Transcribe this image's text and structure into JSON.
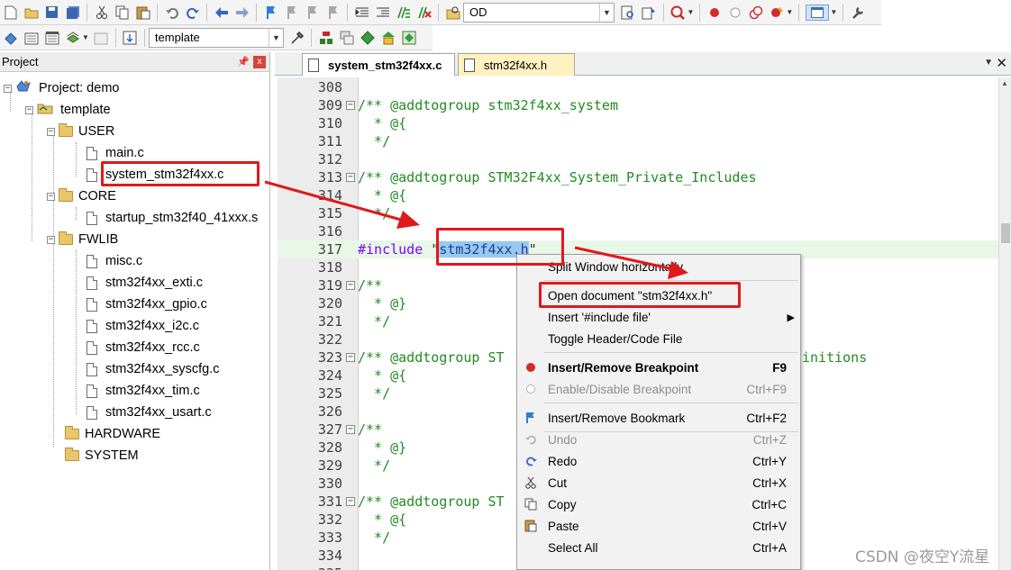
{
  "toolbar1": {
    "target_dropdown": "OD"
  },
  "toolbar2": {
    "target_select": "template"
  },
  "project_panel": {
    "title": "Project",
    "pin": "ᵖ",
    "close": "x",
    "tree": [
      {
        "label": "Project: demo",
        "type": "root"
      },
      {
        "label": "template",
        "type": "target"
      },
      {
        "label": "USER",
        "type": "group"
      },
      {
        "label": "main.c",
        "type": "file"
      },
      {
        "label": "system_stm32f4xx.c",
        "type": "file"
      },
      {
        "label": "CORE",
        "type": "group"
      },
      {
        "label": "startup_stm32f40_41xxx.s",
        "type": "file"
      },
      {
        "label": "FWLIB",
        "type": "group"
      },
      {
        "label": "misc.c",
        "type": "file"
      },
      {
        "label": "stm32f4xx_exti.c",
        "type": "file"
      },
      {
        "label": "stm32f4xx_gpio.c",
        "type": "file"
      },
      {
        "label": "stm32f4xx_i2c.c",
        "type": "file"
      },
      {
        "label": "stm32f4xx_rcc.c",
        "type": "file"
      },
      {
        "label": "stm32f4xx_syscfg.c",
        "type": "file"
      },
      {
        "label": "stm32f4xx_tim.c",
        "type": "file"
      },
      {
        "label": "stm32f4xx_usart.c",
        "type": "file"
      },
      {
        "label": "HARDWARE",
        "type": "group"
      },
      {
        "label": "SYSTEM",
        "type": "group"
      }
    ]
  },
  "editor": {
    "tabs": [
      {
        "label": "system_stm32f4xx.c",
        "active": true
      },
      {
        "label": "stm32f4xx.h",
        "active": false
      }
    ],
    "lines": [
      {
        "n": "308",
        "text": ""
      },
      {
        "n": "309",
        "text": "/** @addtogroup stm32f4xx_system"
      },
      {
        "n": "310",
        "text": "  * @{"
      },
      {
        "n": "311",
        "text": "  */"
      },
      {
        "n": "312",
        "text": ""
      },
      {
        "n": "313",
        "text": "/** @addtogroup STM32F4xx_System_Private_Includes"
      },
      {
        "n": "314",
        "text": "  * @{"
      },
      {
        "n": "315",
        "text": "  */"
      },
      {
        "n": "316",
        "text": ""
      },
      {
        "n": "317",
        "text": ""
      },
      {
        "n": "318",
        "text": ""
      },
      {
        "n": "319",
        "text": "/**"
      },
      {
        "n": "320",
        "text": "  * @}"
      },
      {
        "n": "321",
        "text": "  */"
      },
      {
        "n": "322",
        "text": ""
      },
      {
        "n": "323",
        "text": "/** @addtogroup ST"
      },
      {
        "n": "324",
        "text": "  * @{"
      },
      {
        "n": "325",
        "text": "  */"
      },
      {
        "n": "326",
        "text": ""
      },
      {
        "n": "327",
        "text": "/**"
      },
      {
        "n": "328",
        "text": "  * @}"
      },
      {
        "n": "329",
        "text": "  */"
      },
      {
        "n": "330",
        "text": ""
      },
      {
        "n": "331",
        "text": "/** @addtogroup ST"
      },
      {
        "n": "332",
        "text": "  * @{"
      },
      {
        "n": "333",
        "text": "  */"
      },
      {
        "n": "334",
        "text": ""
      },
      {
        "n": "335",
        "text": ""
      }
    ],
    "include_line": {
      "directive": "#include ",
      "open_quote": "\"",
      "selected": "stm32f4xx.h",
      "close_quote": "\""
    },
    "line323_tail": "initions"
  },
  "context_menu": {
    "items": [
      {
        "label": "Split Window horizontally",
        "shortcut": ""
      },
      {
        "label": "Open document \"stm32f4xx.h\"",
        "shortcut": ""
      },
      {
        "label": "Insert '#include file'",
        "shortcut": "▶"
      },
      {
        "label": "Toggle Header/Code File",
        "shortcut": ""
      },
      {
        "label": "Insert/Remove Breakpoint",
        "shortcut": "F9"
      },
      {
        "label": "Enable/Disable Breakpoint",
        "shortcut": "Ctrl+F9"
      },
      {
        "label": "Insert/Remove Bookmark",
        "shortcut": "Ctrl+F2"
      },
      {
        "label": "Undo",
        "shortcut": "Ctrl+Z"
      },
      {
        "label": "Redo",
        "shortcut": "Ctrl+Y"
      },
      {
        "label": "Cut",
        "shortcut": "Ctrl+X"
      },
      {
        "label": "Copy",
        "shortcut": "Ctrl+C"
      },
      {
        "label": "Paste",
        "shortcut": "Ctrl+V"
      },
      {
        "label": "Select All",
        "shortcut": "Ctrl+A"
      }
    ]
  },
  "watermark": "CSDN @夜空Y流星",
  "colors": {
    "annotation_red": "#e0191b",
    "comment_green": "#238b22",
    "selection_blue": "#99c9ef",
    "breakpoint_red": "#d32b2b"
  }
}
